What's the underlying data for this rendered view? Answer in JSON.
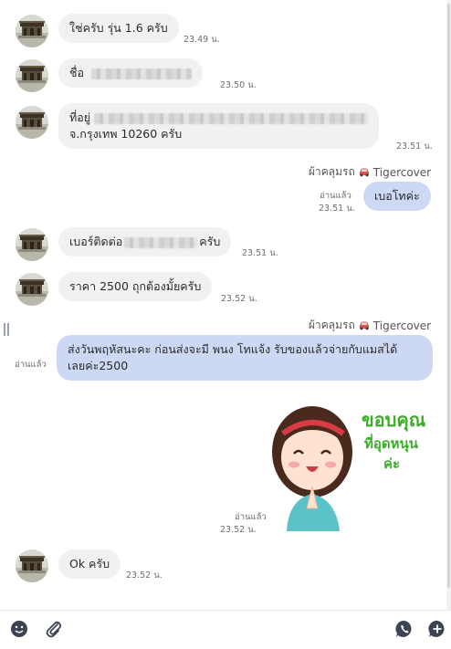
{
  "messages": [
    {
      "text": "ใช่ครับ รุ่น 1.6 ครับ",
      "time": "23.49 น."
    },
    {
      "prefix": "ชื่อ",
      "time": "23.50 น."
    },
    {
      "prefix": "ที่อยู่",
      "line2": "จ.กรุงเทพ 10260 ครับ",
      "time": "23.51 น."
    },
    {
      "sender": "ผ้าคลุมรถ",
      "sender_suffix": "Tigercover",
      "text": "เบอโทค่ะ",
      "read": "อ่านแล้ว",
      "time": "23.51 น."
    },
    {
      "prefix": "เบอร์ติดต่อ",
      "suffix": "ครับ",
      "time": "23.51 น."
    },
    {
      "text": "ราคา 2500 ถุกต้องมั้ยครับ",
      "time": "23.52 น."
    },
    {
      "sender": "ผ้าคลุมรถ",
      "sender_suffix": "Tigercover",
      "line1": "ส่งวันพฤหัสนะคะ ก่อนส่งจะมี พนง โทแจ้ง รับของแล้วจ่ายกับแมสได้",
      "line2": "เลยค่ะ2500",
      "read": "อ่านแล้ว"
    },
    {
      "sticker_line1": "ขอบคุณ",
      "sticker_line2": "ที่อุดหนุน",
      "sticker_line3": "ค่ะ",
      "read": "อ่านแล้ว",
      "time": "23.52 น."
    },
    {
      "text": "Ok ครับ",
      "time": "23.52 น."
    }
  ],
  "toolbar": {
    "icons": [
      "emoji-icon",
      "attachment-icon",
      "call-icon",
      "add-icon"
    ]
  },
  "colors": {
    "incoming_bubble": "#f1f1f3",
    "outgoing_bubble": "#cdd9f4",
    "sticker_text": "#3cae2a",
    "toolbar_icon": "#3c4454"
  }
}
